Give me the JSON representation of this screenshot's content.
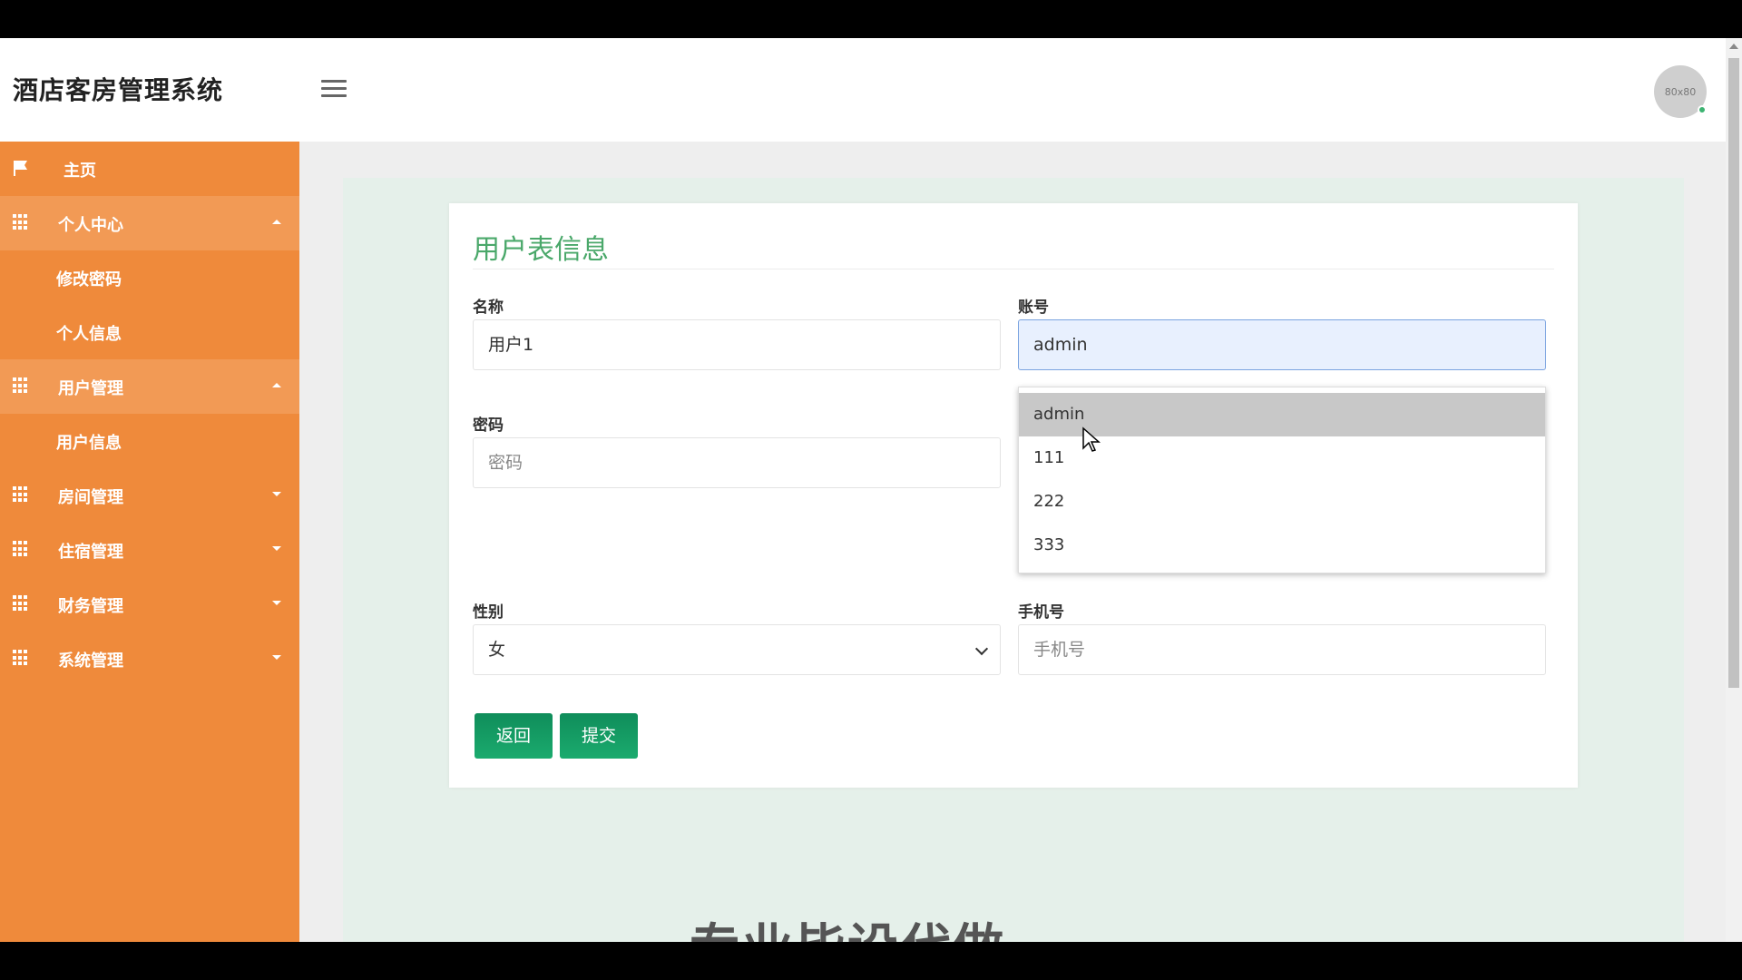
{
  "app": {
    "title": "酒店客房管理系统",
    "avatar_text": "80x80"
  },
  "sidebar": {
    "items": [
      {
        "label": "主页"
      },
      {
        "label": "个人中心",
        "children": [
          {
            "label": "修改密码"
          },
          {
            "label": "个人信息"
          }
        ]
      },
      {
        "label": "用户管理",
        "children": [
          {
            "label": "用户信息"
          }
        ]
      },
      {
        "label": "房间管理"
      },
      {
        "label": "住宿管理"
      },
      {
        "label": "财务管理"
      },
      {
        "label": "系统管理"
      }
    ]
  },
  "form": {
    "title": "用户表信息",
    "name": {
      "label": "名称",
      "value": "用户1"
    },
    "account": {
      "label": "账号",
      "value": "admin"
    },
    "password": {
      "label": "密码",
      "placeholder": "密码"
    },
    "gender": {
      "label": "性别",
      "selected": "女"
    },
    "phone": {
      "label": "手机号",
      "placeholder": "手机号"
    },
    "autocomplete": [
      "admin",
      "111",
      "222",
      "333"
    ],
    "buttons": {
      "back": "返回",
      "submit": "提交"
    }
  },
  "background": {
    "watermark": "专业毕设代做"
  },
  "colors": {
    "sidebar": "#ef8a3b",
    "accent_green": "#4aa86a",
    "button_green": "#0f8d5a"
  },
  "icons": {
    "menu": "hamburger-icon",
    "home": "flag-icon",
    "section": "grid-icon"
  }
}
